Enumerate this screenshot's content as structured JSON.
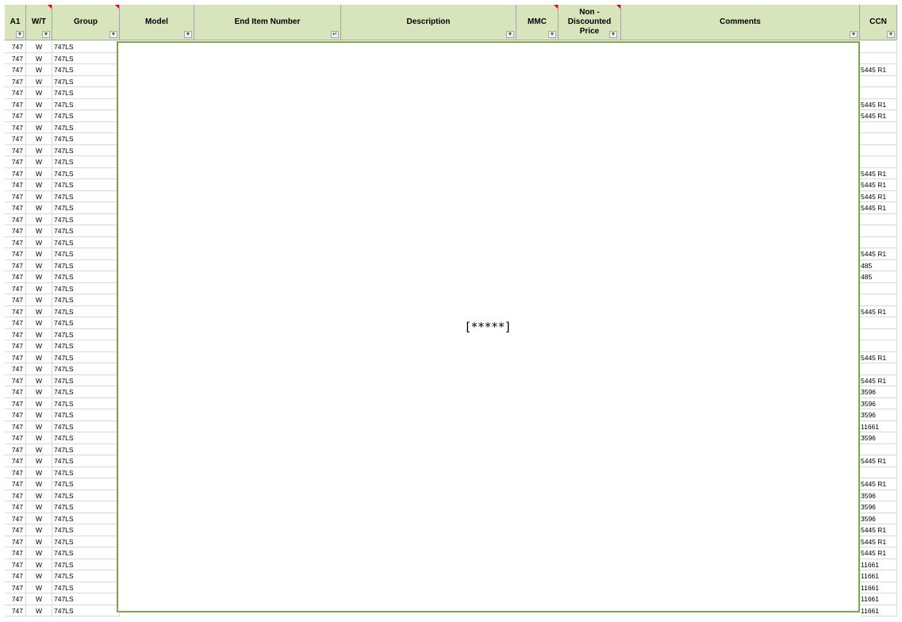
{
  "headers": {
    "a1": "A1",
    "wt": "W/T",
    "group": "Group",
    "model": "Model",
    "end_item_number": "End Item Number",
    "description": "Description",
    "mmc": "MMC",
    "price_1": "Non -",
    "price_2": "Discounted",
    "price_3": "Price",
    "comments": "Comments",
    "ccn": "CCN"
  },
  "redaction_text": "[*****]",
  "rows": [
    {
      "a1": "747",
      "wt": "W",
      "group": "747LS",
      "ccn": ""
    },
    {
      "a1": "747",
      "wt": "W",
      "group": "747LS",
      "ccn": ""
    },
    {
      "a1": "747",
      "wt": "W",
      "group": "747LS",
      "ccn": "5445 R1"
    },
    {
      "a1": "747",
      "wt": "W",
      "group": "747LS",
      "ccn": ""
    },
    {
      "a1": "747",
      "wt": "W",
      "group": "747LS",
      "ccn": ""
    },
    {
      "a1": "747",
      "wt": "W",
      "group": "747LS",
      "ccn": "5445 R1"
    },
    {
      "a1": "747",
      "wt": "W",
      "group": "747LS",
      "ccn": "5445 R1"
    },
    {
      "a1": "747",
      "wt": "W",
      "group": "747LS",
      "ccn": ""
    },
    {
      "a1": "747",
      "wt": "W",
      "group": "747LS",
      "ccn": ""
    },
    {
      "a1": "747",
      "wt": "W",
      "group": "747LS",
      "ccn": ""
    },
    {
      "a1": "747",
      "wt": "W",
      "group": "747LS",
      "ccn": ""
    },
    {
      "a1": "747",
      "wt": "W",
      "group": "747LS",
      "ccn": "5445 R1"
    },
    {
      "a1": "747",
      "wt": "W",
      "group": "747LS",
      "ccn": "5445 R1"
    },
    {
      "a1": "747",
      "wt": "W",
      "group": "747LS",
      "ccn": "5445 R1"
    },
    {
      "a1": "747",
      "wt": "W",
      "group": "747LS",
      "ccn": "5445 R1"
    },
    {
      "a1": "747",
      "wt": "W",
      "group": "747LS",
      "ccn": ""
    },
    {
      "a1": "747",
      "wt": "W",
      "group": "747LS",
      "ccn": ""
    },
    {
      "a1": "747",
      "wt": "W",
      "group": "747LS",
      "ccn": ""
    },
    {
      "a1": "747",
      "wt": "W",
      "group": "747LS",
      "ccn": "5445 R1"
    },
    {
      "a1": "747",
      "wt": "W",
      "group": "747LS",
      "ccn": "485"
    },
    {
      "a1": "747",
      "wt": "W",
      "group": "747LS",
      "ccn": "485"
    },
    {
      "a1": "747",
      "wt": "W",
      "group": "747LS",
      "ccn": ""
    },
    {
      "a1": "747",
      "wt": "W",
      "group": "747LS",
      "ccn": ""
    },
    {
      "a1": "747",
      "wt": "W",
      "group": "747LS",
      "ccn": "5445 R1"
    },
    {
      "a1": "747",
      "wt": "W",
      "group": "747LS",
      "ccn": ""
    },
    {
      "a1": "747",
      "wt": "W",
      "group": "747LS",
      "ccn": ""
    },
    {
      "a1": "747",
      "wt": "W",
      "group": "747LS",
      "ccn": ""
    },
    {
      "a1": "747",
      "wt": "W",
      "group": "747LS",
      "ccn": "5445 R1"
    },
    {
      "a1": "747",
      "wt": "W",
      "group": "747LS",
      "ccn": ""
    },
    {
      "a1": "747",
      "wt": "W",
      "group": "747LS",
      "ccn": "5445 R1"
    },
    {
      "a1": "747",
      "wt": "W",
      "group": "747LS",
      "ccn": "3596"
    },
    {
      "a1": "747",
      "wt": "W",
      "group": "747LS",
      "ccn": "3596"
    },
    {
      "a1": "747",
      "wt": "W",
      "group": "747LS",
      "ccn": "3596"
    },
    {
      "a1": "747",
      "wt": "W",
      "group": "747LS",
      "ccn": "11661"
    },
    {
      "a1": "747",
      "wt": "W",
      "group": "747LS",
      "ccn": "3596"
    },
    {
      "a1": "747",
      "wt": "W",
      "group": "747LS",
      "ccn": ""
    },
    {
      "a1": "747",
      "wt": "W",
      "group": "747LS",
      "ccn": "5445 R1"
    },
    {
      "a1": "747",
      "wt": "W",
      "group": "747LS",
      "ccn": ""
    },
    {
      "a1": "747",
      "wt": "W",
      "group": "747LS",
      "ccn": "5445 R1"
    },
    {
      "a1": "747",
      "wt": "W",
      "group": "747LS",
      "ccn": "3596"
    },
    {
      "a1": "747",
      "wt": "W",
      "group": "747LS",
      "ccn": "3596"
    },
    {
      "a1": "747",
      "wt": "W",
      "group": "747LS",
      "ccn": "3596"
    },
    {
      "a1": "747",
      "wt": "W",
      "group": "747LS",
      "ccn": "5445 R1"
    },
    {
      "a1": "747",
      "wt": "W",
      "group": "747LS",
      "ccn": "5445 R1"
    },
    {
      "a1": "747",
      "wt": "W",
      "group": "747LS",
      "ccn": "5445 R1"
    },
    {
      "a1": "747",
      "wt": "W",
      "group": "747LS",
      "ccn": "11661"
    },
    {
      "a1": "747",
      "wt": "W",
      "group": "747LS",
      "ccn": "11661"
    },
    {
      "a1": "747",
      "wt": "W",
      "group": "747LS",
      "ccn": "11661"
    },
    {
      "a1": "747",
      "wt": "W",
      "group": "747LS",
      "ccn": "11661"
    },
    {
      "a1": "747",
      "wt": "W",
      "group": "747LS",
      "ccn": "11661"
    }
  ]
}
